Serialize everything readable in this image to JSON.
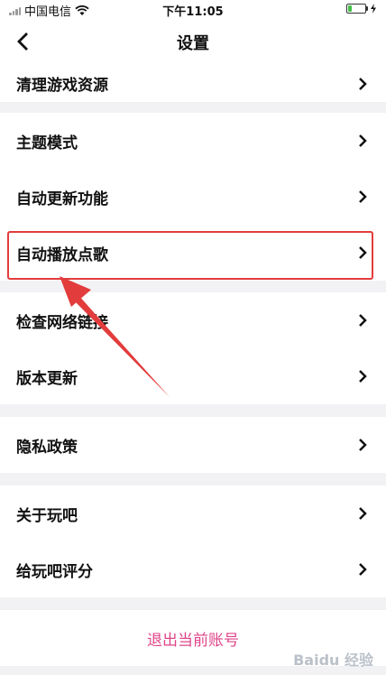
{
  "status_bar": {
    "carrier": "中国电信",
    "time": "下午11:05"
  },
  "nav": {
    "title": "设置"
  },
  "groups": [
    {
      "items": [
        {
          "label": "清理游戏资源"
        }
      ]
    },
    {
      "items": [
        {
          "label": "主题模式"
        },
        {
          "label": "自动更新功能"
        },
        {
          "label": "自动播放点歌"
        }
      ]
    },
    {
      "items": [
        {
          "label": "检查网络链接"
        },
        {
          "label": "版本更新"
        }
      ]
    },
    {
      "items": [
        {
          "label": "隐私政策"
        }
      ]
    },
    {
      "items": [
        {
          "label": "关于玩吧"
        },
        {
          "label": "给玩吧评分"
        }
      ]
    }
  ],
  "logout": {
    "label": "退出当前账号"
  },
  "watermark": "Baidu 经验",
  "colors": {
    "accent": "#e0458a",
    "highlight": "#e23c3c",
    "battery": "#44c147"
  }
}
